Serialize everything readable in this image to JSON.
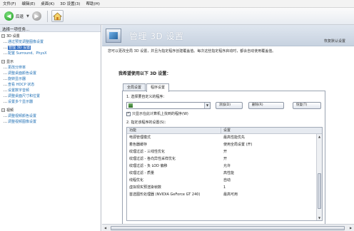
{
  "menu": [
    "文件(F)",
    "编辑(E)",
    "桌面(K)",
    "3D 设置(3)",
    "帮助(H)"
  ],
  "toolbar": {
    "back_label": "后退"
  },
  "sidebar": {
    "title": "选择一项任务...",
    "groups": [
      {
        "label": "3D 设置",
        "items": [
          {
            "label": "通过预览调整图像设置",
            "selected": false
          },
          {
            "label": "管理 3D 设置",
            "selected": true
          },
          {
            "label": "配置 Surround、PhysX",
            "selected": false
          }
        ]
      },
      {
        "label": "显示",
        "items": [
          {
            "label": "更改分辨率",
            "selected": false
          },
          {
            "label": "调整桌面颜色设置",
            "selected": false
          },
          {
            "label": "旋转显示器",
            "selected": false
          },
          {
            "label": "查看 HDCP 状态",
            "selected": false
          },
          {
            "label": "设置数字音频",
            "selected": false
          },
          {
            "label": "调整桌面尺寸和位置",
            "selected": false
          },
          {
            "label": "设置多个显示器",
            "selected": false
          }
        ]
      },
      {
        "label": "视频",
        "items": [
          {
            "label": "调整视频颜色设置",
            "selected": false
          },
          {
            "label": "调整视频图像设置",
            "selected": false
          }
        ]
      }
    ]
  },
  "page": {
    "title": "管理 3D 设置",
    "restore": "恢复默认设置",
    "description": "您可以更改全局 3D 设置，并且为指定程序创建覆盖值。每次这些指定程序启动时，都会自动使用覆盖值。",
    "section_label": "我希望使用以下 3D 设置：",
    "tabs": [
      "全局设置",
      "程序设置"
    ],
    "step1_label": "1. 选择要自定义的程序：",
    "program_value": "",
    "add_button": "添加(D)",
    "remove_button": "删除(R)",
    "restore_button": "恢复(T)",
    "checkbox_label": "只显示在此计算机上找到的程序(W)",
    "checkbox_checked": true,
    "step2_label": "2. 指定该程序的设置(S)：",
    "table": {
      "columns": [
        "功能",
        "设置"
      ],
      "rows": [
        [
          "电源管理模式",
          "最高性能优先"
        ],
        [
          "着色器缓存",
          "使用全局设置 (开)"
        ],
        [
          "纹理过滤 - 三线性优化",
          "开"
        ],
        [
          "纹理过滤 - 各向异性采样优化",
          "开"
        ],
        [
          "纹理过滤 - 负 LOD 偏移",
          "允许"
        ],
        [
          "纹理过滤 - 质量",
          "高性能"
        ],
        [
          "线程优化",
          "自动"
        ],
        [
          "虚拟现实预渲染帧数",
          "1"
        ],
        [
          "首选图形处理器 (NVIDIA GeForce GT 240)",
          "最高可用"
        ]
      ]
    }
  }
}
